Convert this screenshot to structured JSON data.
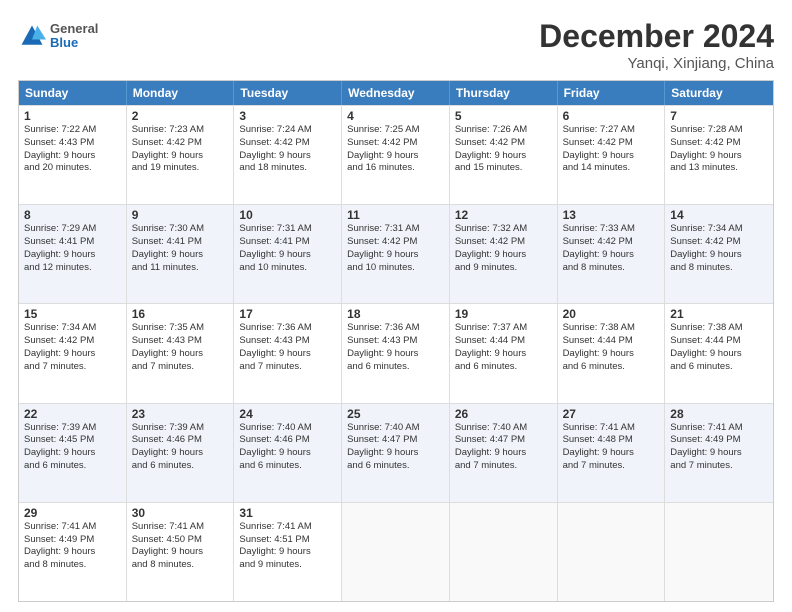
{
  "logo": {
    "general": "General",
    "blue": "Blue"
  },
  "title": {
    "month": "December 2024",
    "location": "Yanqi, Xinjiang, China"
  },
  "header_days": [
    "Sunday",
    "Monday",
    "Tuesday",
    "Wednesday",
    "Thursday",
    "Friday",
    "Saturday"
  ],
  "rows": [
    {
      "alt": false,
      "cells": [
        {
          "day": "1",
          "lines": [
            "Sunrise: 7:22 AM",
            "Sunset: 4:43 PM",
            "Daylight: 9 hours",
            "and 20 minutes."
          ]
        },
        {
          "day": "2",
          "lines": [
            "Sunrise: 7:23 AM",
            "Sunset: 4:42 PM",
            "Daylight: 9 hours",
            "and 19 minutes."
          ]
        },
        {
          "day": "3",
          "lines": [
            "Sunrise: 7:24 AM",
            "Sunset: 4:42 PM",
            "Daylight: 9 hours",
            "and 18 minutes."
          ]
        },
        {
          "day": "4",
          "lines": [
            "Sunrise: 7:25 AM",
            "Sunset: 4:42 PM",
            "Daylight: 9 hours",
            "and 16 minutes."
          ]
        },
        {
          "day": "5",
          "lines": [
            "Sunrise: 7:26 AM",
            "Sunset: 4:42 PM",
            "Daylight: 9 hours",
            "and 15 minutes."
          ]
        },
        {
          "day": "6",
          "lines": [
            "Sunrise: 7:27 AM",
            "Sunset: 4:42 PM",
            "Daylight: 9 hours",
            "and 14 minutes."
          ]
        },
        {
          "day": "7",
          "lines": [
            "Sunrise: 7:28 AM",
            "Sunset: 4:42 PM",
            "Daylight: 9 hours",
            "and 13 minutes."
          ]
        }
      ]
    },
    {
      "alt": true,
      "cells": [
        {
          "day": "8",
          "lines": [
            "Sunrise: 7:29 AM",
            "Sunset: 4:41 PM",
            "Daylight: 9 hours",
            "and 12 minutes."
          ]
        },
        {
          "day": "9",
          "lines": [
            "Sunrise: 7:30 AM",
            "Sunset: 4:41 PM",
            "Daylight: 9 hours",
            "and 11 minutes."
          ]
        },
        {
          "day": "10",
          "lines": [
            "Sunrise: 7:31 AM",
            "Sunset: 4:41 PM",
            "Daylight: 9 hours",
            "and 10 minutes."
          ]
        },
        {
          "day": "11",
          "lines": [
            "Sunrise: 7:31 AM",
            "Sunset: 4:42 PM",
            "Daylight: 9 hours",
            "and 10 minutes."
          ]
        },
        {
          "day": "12",
          "lines": [
            "Sunrise: 7:32 AM",
            "Sunset: 4:42 PM",
            "Daylight: 9 hours",
            "and 9 minutes."
          ]
        },
        {
          "day": "13",
          "lines": [
            "Sunrise: 7:33 AM",
            "Sunset: 4:42 PM",
            "Daylight: 9 hours",
            "and 8 minutes."
          ]
        },
        {
          "day": "14",
          "lines": [
            "Sunrise: 7:34 AM",
            "Sunset: 4:42 PM",
            "Daylight: 9 hours",
            "and 8 minutes."
          ]
        }
      ]
    },
    {
      "alt": false,
      "cells": [
        {
          "day": "15",
          "lines": [
            "Sunrise: 7:34 AM",
            "Sunset: 4:42 PM",
            "Daylight: 9 hours",
            "and 7 minutes."
          ]
        },
        {
          "day": "16",
          "lines": [
            "Sunrise: 7:35 AM",
            "Sunset: 4:43 PM",
            "Daylight: 9 hours",
            "and 7 minutes."
          ]
        },
        {
          "day": "17",
          "lines": [
            "Sunrise: 7:36 AM",
            "Sunset: 4:43 PM",
            "Daylight: 9 hours",
            "and 7 minutes."
          ]
        },
        {
          "day": "18",
          "lines": [
            "Sunrise: 7:36 AM",
            "Sunset: 4:43 PM",
            "Daylight: 9 hours",
            "and 6 minutes."
          ]
        },
        {
          "day": "19",
          "lines": [
            "Sunrise: 7:37 AM",
            "Sunset: 4:44 PM",
            "Daylight: 9 hours",
            "and 6 minutes."
          ]
        },
        {
          "day": "20",
          "lines": [
            "Sunrise: 7:38 AM",
            "Sunset: 4:44 PM",
            "Daylight: 9 hours",
            "and 6 minutes."
          ]
        },
        {
          "day": "21",
          "lines": [
            "Sunrise: 7:38 AM",
            "Sunset: 4:44 PM",
            "Daylight: 9 hours",
            "and 6 minutes."
          ]
        }
      ]
    },
    {
      "alt": true,
      "cells": [
        {
          "day": "22",
          "lines": [
            "Sunrise: 7:39 AM",
            "Sunset: 4:45 PM",
            "Daylight: 9 hours",
            "and 6 minutes."
          ]
        },
        {
          "day": "23",
          "lines": [
            "Sunrise: 7:39 AM",
            "Sunset: 4:46 PM",
            "Daylight: 9 hours",
            "and 6 minutes."
          ]
        },
        {
          "day": "24",
          "lines": [
            "Sunrise: 7:40 AM",
            "Sunset: 4:46 PM",
            "Daylight: 9 hours",
            "and 6 minutes."
          ]
        },
        {
          "day": "25",
          "lines": [
            "Sunrise: 7:40 AM",
            "Sunset: 4:47 PM",
            "Daylight: 9 hours",
            "and 6 minutes."
          ]
        },
        {
          "day": "26",
          "lines": [
            "Sunrise: 7:40 AM",
            "Sunset: 4:47 PM",
            "Daylight: 9 hours",
            "and 7 minutes."
          ]
        },
        {
          "day": "27",
          "lines": [
            "Sunrise: 7:41 AM",
            "Sunset: 4:48 PM",
            "Daylight: 9 hours",
            "and 7 minutes."
          ]
        },
        {
          "day": "28",
          "lines": [
            "Sunrise: 7:41 AM",
            "Sunset: 4:49 PM",
            "Daylight: 9 hours",
            "and 7 minutes."
          ]
        }
      ]
    },
    {
      "alt": false,
      "cells": [
        {
          "day": "29",
          "lines": [
            "Sunrise: 7:41 AM",
            "Sunset: 4:49 PM",
            "Daylight: 9 hours",
            "and 8 minutes."
          ]
        },
        {
          "day": "30",
          "lines": [
            "Sunrise: 7:41 AM",
            "Sunset: 4:50 PM",
            "Daylight: 9 hours",
            "and 8 minutes."
          ]
        },
        {
          "day": "31",
          "lines": [
            "Sunrise: 7:41 AM",
            "Sunset: 4:51 PM",
            "Daylight: 9 hours",
            "and 9 minutes."
          ]
        },
        {
          "day": "",
          "lines": []
        },
        {
          "day": "",
          "lines": []
        },
        {
          "day": "",
          "lines": []
        },
        {
          "day": "",
          "lines": []
        }
      ]
    }
  ]
}
